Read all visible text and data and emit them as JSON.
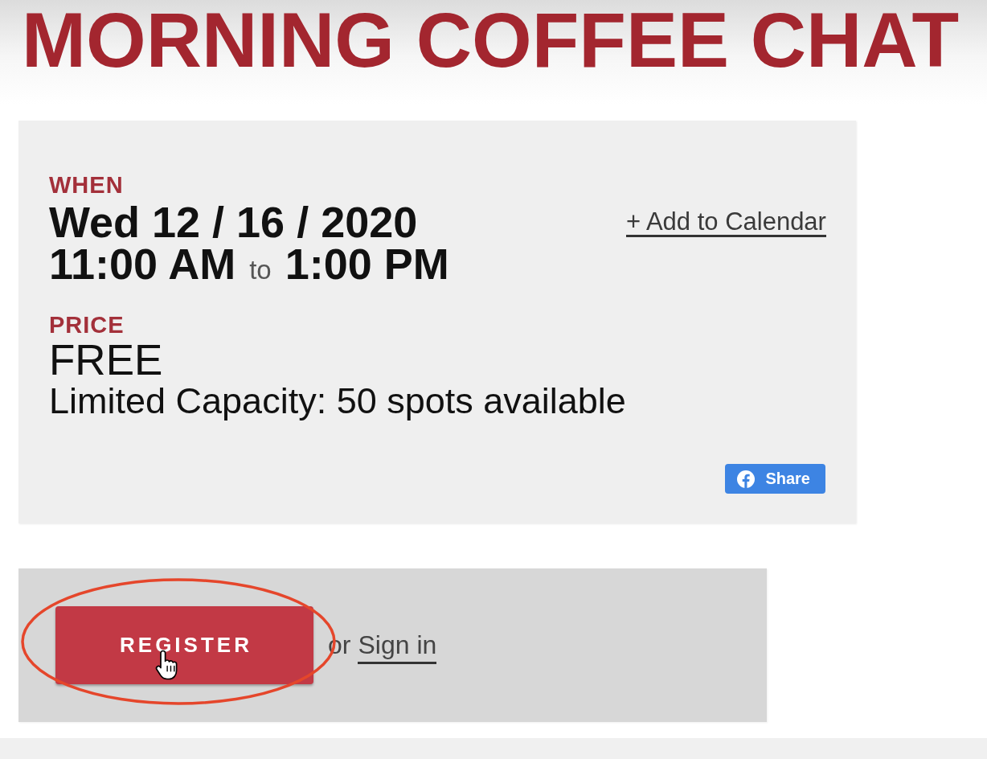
{
  "page": {
    "title": "MORNING COFFEE CHAT"
  },
  "event_card": {
    "when": {
      "label": "WHEN",
      "date": "Wed 12 / 16 / 2020",
      "start_time": "11:00 AM",
      "separator": "to",
      "end_time": "1:00 PM"
    },
    "add_to_calendar": "+ Add to Calendar",
    "price": {
      "label": "PRICE",
      "value": "FREE",
      "capacity": "Limited Capacity: 50 spots available"
    },
    "share_button": {
      "label": "Share"
    }
  },
  "registration": {
    "register_button": {
      "label": "REGISTER",
      "highlighted": true,
      "hovered": true
    },
    "or_text": "or",
    "sign_in_link": "Sign in"
  }
}
